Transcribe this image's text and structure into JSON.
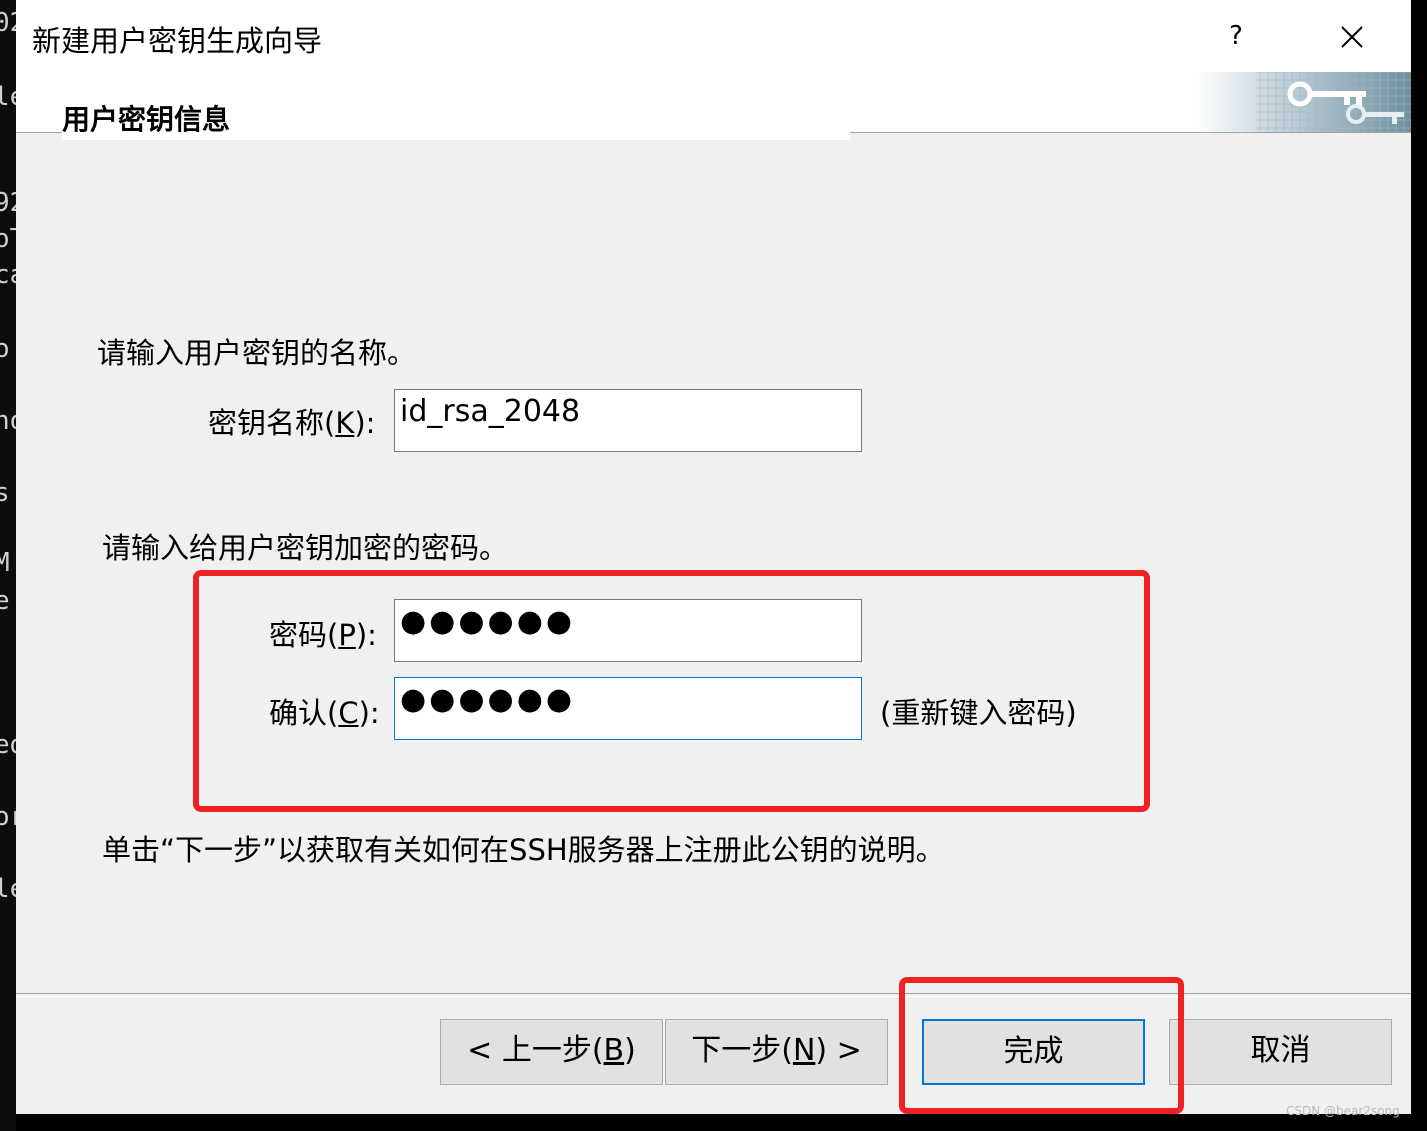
{
  "background_terminal": {
    "fragments": [
      "02",
      "le",
      "92",
      "oT",
      "ca",
      "o",
      "no",
      "s",
      "M",
      "e",
      "ed",
      "or",
      "le"
    ]
  },
  "window": {
    "title": "新建用户密钥生成向导",
    "help_label": "?",
    "close_icon": "close-icon"
  },
  "header": {
    "title": "用户密钥信息",
    "banner_icon": "keys-banner-icon"
  },
  "form": {
    "name_prompt": "请输入用户密钥的名称。",
    "key_name_label": "密钥名称(",
    "key_name_mnemonic": "K",
    "key_name_label_end": "):",
    "key_name_value": "id_rsa_2048",
    "password_prompt": "请输入给用户密钥加密的密码。",
    "password_label": "密码(",
    "password_mnemonic": "P",
    "password_label_end": "):",
    "password_value": "●●●●●●",
    "confirm_label": "确认(",
    "confirm_mnemonic": "C",
    "confirm_label_end": "):",
    "confirm_value": "●●●●●●",
    "confirm_hint": "(重新键入密码)",
    "next_info": "单击“下一步”以获取有关如何在SSH服务器上注册此公钥的说明。"
  },
  "buttons": {
    "back_pre": "< 上一步(",
    "back_mnemonic": "B",
    "back_post": ")",
    "next_pre": "下一步(",
    "next_mnemonic": "N",
    "next_post": ") >",
    "finish": "完成",
    "cancel": "取消"
  },
  "annotations": {
    "highlight_color": "#ee2222"
  },
  "watermark": "CSDN @bear2song"
}
